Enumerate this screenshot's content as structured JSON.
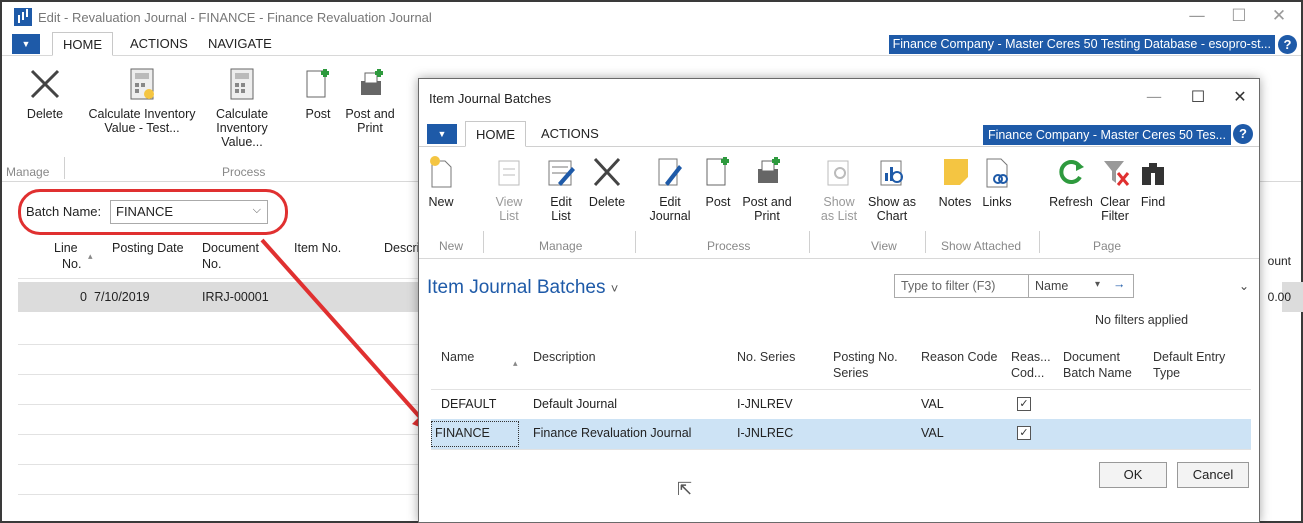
{
  "window": {
    "title": "Edit - Revaluation Journal - FINANCE - Finance Revaluation Journal",
    "controls": {
      "minimize": "—",
      "maximize": "☐",
      "close": "✕"
    }
  },
  "ribbon_tabs": {
    "menu": "▼",
    "home": "HOME",
    "actions": "ACTIONS",
    "navigate": "NAVIGATE"
  },
  "company": "Finance Company - Master Ceres 50 Testing Database - esopro-st...",
  "help": "?",
  "ribbon": {
    "delete": "Delete",
    "calc_test": [
      "Calculate Inventory",
      "Value - Test..."
    ],
    "calc": [
      "Calculate",
      "Inventory Value..."
    ],
    "post": "Post",
    "post_print": [
      "Post and",
      "Print"
    ],
    "group_manage": "Manage",
    "group_process": "Process"
  },
  "batch": {
    "label": "Batch Name:",
    "value": "FINANCE"
  },
  "grid": {
    "headers": {
      "line": [
        "Line",
        "No."
      ],
      "posting_date": "Posting Date",
      "document": [
        "Document",
        "No."
      ],
      "item": "Item No.",
      "descr": "Descri"
    },
    "row": {
      "line_no": "0",
      "date": "7/10/2019",
      "doc_no": "IRRJ-00001"
    },
    "amount_head": "ount",
    "amount_val": "0.00"
  },
  "dialog": {
    "title": "Item Journal Batches",
    "controls": {
      "minimize": "—",
      "maximize": "☐",
      "close": "✕"
    },
    "tabs": {
      "menu": "▼",
      "home": "HOME",
      "actions": "ACTIONS"
    },
    "company": "Finance Company - Master Ceres 50 Tes...",
    "help": "?",
    "ribbon": {
      "new": "New",
      "view_list": [
        "View",
        "List"
      ],
      "edit_list": [
        "Edit",
        "List"
      ],
      "delete": "Delete",
      "edit_journal": [
        "Edit",
        "Journal"
      ],
      "post": "Post",
      "post_print": [
        "Post and",
        "Print"
      ],
      "show_list": [
        "Show",
        "as List"
      ],
      "show_chart": [
        "Show as",
        "Chart"
      ],
      "notes": "Notes",
      "links": "Links",
      "refresh": "Refresh",
      "clear_filter": [
        "Clear",
        "Filter"
      ],
      "find": "Find",
      "groups": {
        "new": "New",
        "manage": "Manage",
        "process": "Process",
        "view": "View",
        "show_attached": "Show Attached",
        "page": "Page"
      }
    },
    "list_title": "Item Journal Batches",
    "list_title_caret": "˅",
    "filter": {
      "placeholder": "Type to filter (F3)",
      "field": "Name",
      "dropdown": "▾",
      "go": "→"
    },
    "collapse": "⌄",
    "no_filters": "No filters applied",
    "columns": {
      "name": "Name",
      "description": "Description",
      "no_series": "No. Series",
      "posting_no_series": [
        "Posting No.",
        "Series"
      ],
      "reason_code": "Reason Code",
      "reas_cod": [
        "Reas...",
        "Cod..."
      ],
      "doc_batch": [
        "Document",
        "Batch Name"
      ],
      "default_entry": [
        "Default Entry",
        "Type"
      ]
    },
    "rows": [
      {
        "name": "DEFAULT",
        "description": "Default Journal",
        "no_series": "I-JNLREV",
        "reason_code": "VAL",
        "check": "✓"
      },
      {
        "name": "FINANCE",
        "description": "Finance Revaluation Journal",
        "no_series": "I-JNLREC",
        "reason_code": "VAL",
        "check": "✓"
      }
    ],
    "ok": "OK",
    "cancel": "Cancel"
  },
  "colors": {
    "accent": "#1e5aa8",
    "highlight_ring": "#e03030",
    "selected_row": "#cde3f5"
  }
}
